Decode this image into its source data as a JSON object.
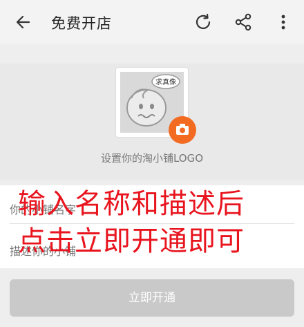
{
  "appbar": {
    "title": "免费开店",
    "icons": [
      "back-arrow-icon",
      "refresh-icon",
      "share-icon",
      "more-vertical-icon"
    ]
  },
  "logo": {
    "badge_text": "求真像",
    "label": "设置你的淘小铺LOGO"
  },
  "form": {
    "name_placeholder": "你的小铺名字",
    "desc_placeholder": "描述你的小铺"
  },
  "overlay": {
    "line1": "输入名称和描述后",
    "line2": "点击立即开通即可"
  },
  "button": {
    "label": "立即开通"
  },
  "colors": {
    "accent": "#f36b21",
    "annotation": "#e8141e",
    "button_disabled": "#c9c9c9"
  }
}
